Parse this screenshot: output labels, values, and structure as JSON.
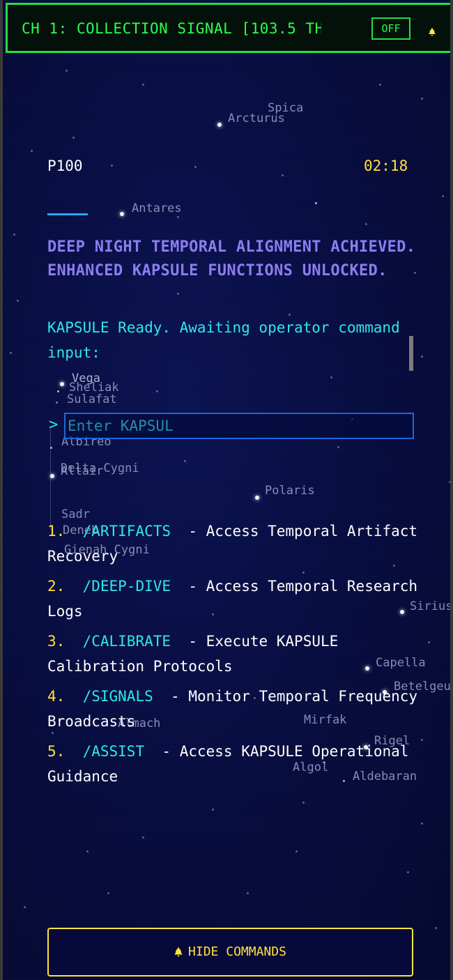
{
  "header": {
    "channel_title": "CH 1: COLLECTION SIGNAL [103.5 TH",
    "off_label": "OFF",
    "bell_icon": "bell-icon"
  },
  "status": {
    "code": "P100",
    "clock": "02:18"
  },
  "messages": {
    "alert": " DEEP NIGHT TEMPORAL ALIGNMENT ACHIEVED. ENHANCED KAPSULE FUNCTIONS UNLOCKED.",
    "ready": " KAPSULE Ready. Awaiting operator command input:"
  },
  "command_input": {
    "prompt": ">",
    "placeholder": "Enter KAPSUL"
  },
  "commands": [
    {
      "num": "1.",
      "name": "/ARTIFACTS",
      "desc": " - Access Temporal Artifact Recovery"
    },
    {
      "num": "2.",
      "name": "/DEEP-DIVE",
      "desc": " - Access Temporal Research Logs"
    },
    {
      "num": "3.",
      "name": "/CALIBRATE",
      "desc": " - Execute KAPSULE Calibration Protocols"
    },
    {
      "num": "4.",
      "name": "/SIGNALS",
      "desc": " - Monitor Temporal Frequency Broadcasts"
    },
    {
      "num": "5.",
      "name": "/ASSIST",
      "desc": " - Access KAPSULE Operational Guidance"
    }
  ],
  "footer": {
    "hide_label": "HIDE COMMANDS"
  },
  "star_labels": {
    "spica": "Spica",
    "arcturus": "Arcturus",
    "antares": "Antares",
    "vega": "Vega",
    "sheliak": "Sheliak",
    "sulafat": "Sulafat",
    "albireo": "Albireo",
    "delta_cygni": "Delta Cygni",
    "altair": "Altair",
    "polaris": "Polaris",
    "sadr": "Sadr",
    "deneb": "Deneb",
    "gienah_cygni": "Gienah Cygni",
    "sirius": "Sirius",
    "capella": "Capella",
    "betelgeuse": "Betelgeu",
    "mirfak": "Mirfak",
    "rigel": "Rigel",
    "algol": "Algol",
    "aldebaran": "Aldebaran",
    "almach": "Almach"
  },
  "colors": {
    "background": "#050a3a",
    "terminal_green": "#2cff4a",
    "cyan": "#2ee8e8",
    "yellow": "#ffe23a",
    "violet": "#8b7df0"
  }
}
